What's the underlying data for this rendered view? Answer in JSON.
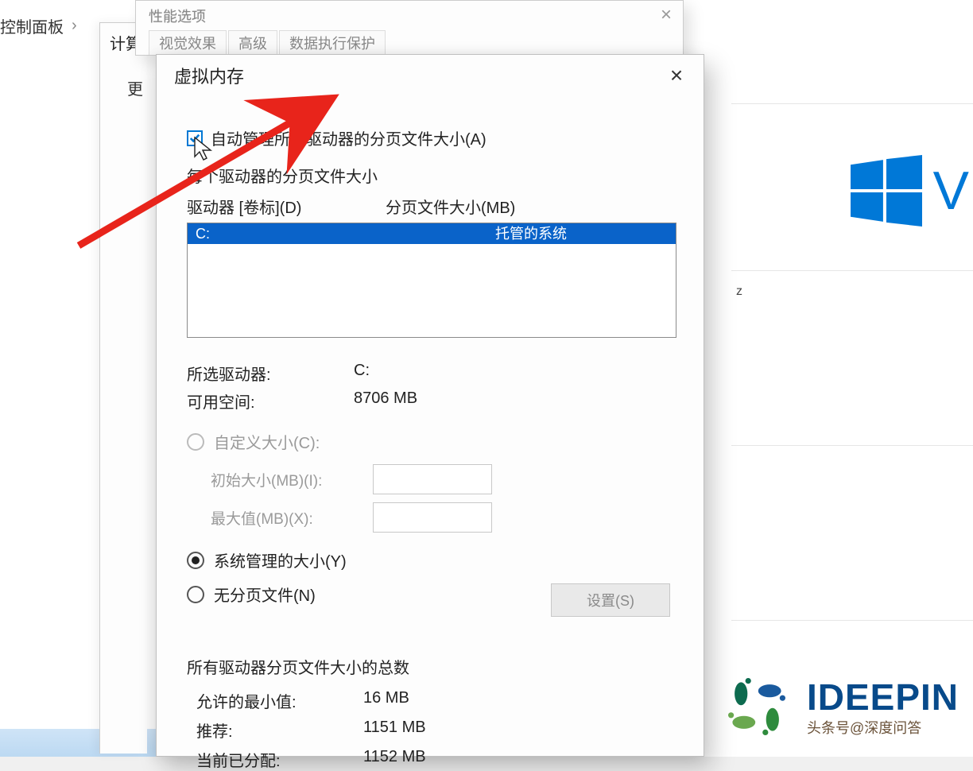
{
  "bg": {
    "breadcrumb": "控制面板",
    "comp_prefix": "计算",
    "win_letter": "V",
    "hz": "z"
  },
  "perf": {
    "title": "性能选项",
    "tab1": "视觉效果",
    "tab2": "高级",
    "tab3": "数据执行保护"
  },
  "stub_letter": "更",
  "vm": {
    "title": "虚拟内存",
    "auto_label": "自动管理所有驱动器的分页文件大小(A)",
    "per_drive_label": "每个驱动器的分页文件大小",
    "col_drive": "驱动器 [卷标](D)",
    "col_size": "分页文件大小(MB)",
    "drive_letter": "C:",
    "drive_status": "托管的系统",
    "selected_drive_label": "所选驱动器:",
    "selected_drive_value": "C:",
    "free_space_label": "可用空间:",
    "free_space_value": "8706 MB",
    "radio_custom": "自定义大小(C):",
    "initial_label": "初始大小(MB)(I):",
    "max_label": "最大值(MB)(X):",
    "radio_system": "系统管理的大小(Y)",
    "radio_none": "无分页文件(N)",
    "set_btn": "设置(S)",
    "totals_hdr": "所有驱动器分页文件大小的总数",
    "min_label": "允许的最小值:",
    "min_value": "16 MB",
    "rec_label": "推荐:",
    "rec_value": "1151 MB",
    "cur_label": "当前已分配:",
    "cur_value": "1152 MB"
  },
  "wm": {
    "brand": "IDEEPIN",
    "sub": "头条号@深度问答"
  }
}
